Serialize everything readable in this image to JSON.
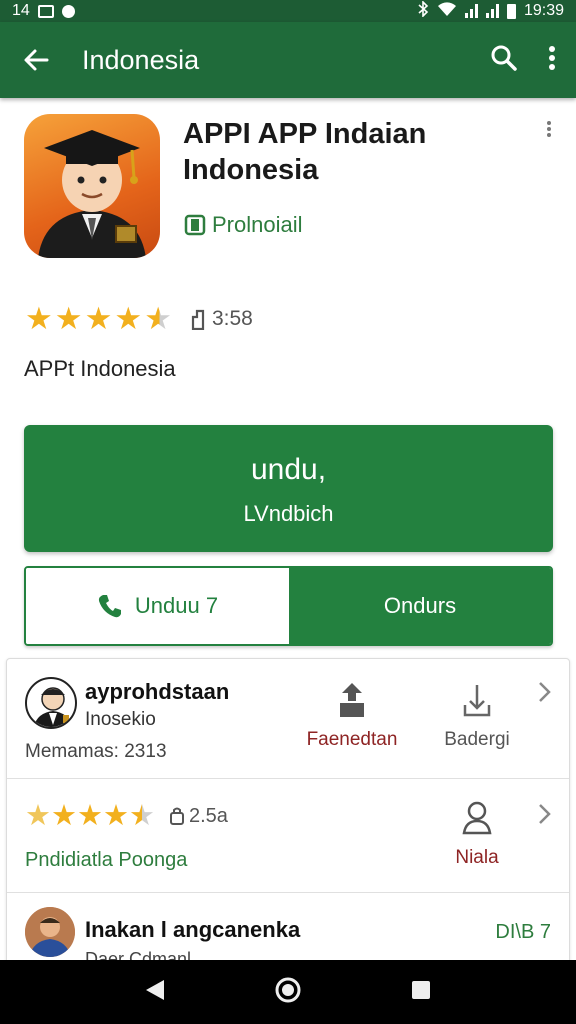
{
  "status_bar": {
    "left_text": "14",
    "time": "19:39"
  },
  "app_bar": {
    "title": "Indonesia"
  },
  "app": {
    "title": "APPI APP Indaian Indonesia",
    "badge": "Prolnoiail",
    "rating_count": "3:58",
    "stars": 4.5,
    "developer": "APPt Indonesia"
  },
  "buttons": {
    "install_main": "undu,",
    "install_sub": "LVndbich",
    "secondary_left": "Unduu 7",
    "secondary_right": "Ondurs"
  },
  "list": {
    "row1": {
      "name": "ayprohdstaan",
      "subtitle": "Inosekio",
      "meta": "Memamas: 2313",
      "action1_label": "Faenedtan",
      "action2_label": "Badergi"
    },
    "row2": {
      "stars": 4.5,
      "count": "2.5a",
      "link": "Pndidiatla Poonga",
      "action_label": "Niala"
    },
    "row3": {
      "name": "Inakan l angcanenka",
      "subtitle": "Daer Cdmanl",
      "badge": "DI\\B 7"
    }
  },
  "colors": {
    "primary": "#1f6b3a",
    "accent_green": "#23813f",
    "star": "#f2b01e",
    "red_text": "#8e2424"
  },
  "icons": {
    "back": "arrow-left-icon",
    "search": "search-icon",
    "more": "more-vert-icon",
    "badge": "verified-badge-icon",
    "phone": "phone-icon",
    "share": "share-icon",
    "chevron": "chevron-right-icon",
    "person": "person-icon"
  }
}
